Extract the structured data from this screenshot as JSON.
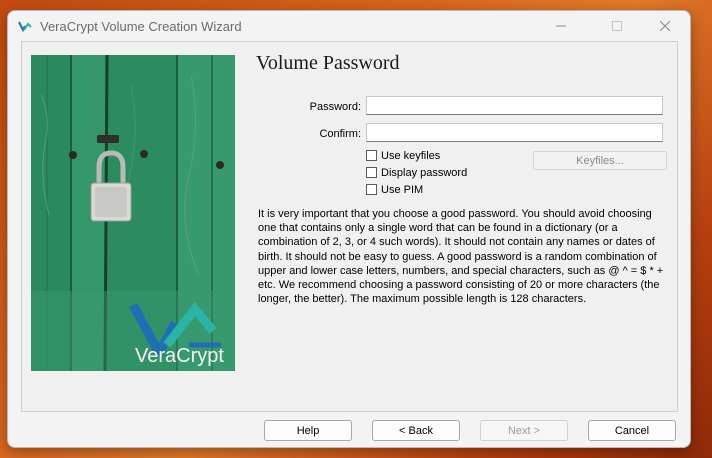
{
  "window": {
    "title": "VeraCrypt Volume Creation Wizard"
  },
  "page": {
    "title": "Volume Password"
  },
  "form": {
    "password_label": "Password:",
    "password_value": "",
    "confirm_label": "Confirm:",
    "confirm_value": "",
    "use_keyfiles_label": "Use keyfiles",
    "use_keyfiles_checked": false,
    "display_password_label": "Display password",
    "display_password_checked": false,
    "use_pim_label": "Use PIM",
    "use_pim_checked": false,
    "keyfiles_button": "Keyfiles..."
  },
  "info": {
    "text": "It is very important that you choose a good password. You should avoid choosing one that contains only a single word that can be found in a dictionary (or a combination of 2, 3, or 4 such words). It should not contain any names or dates of birth. It should not be easy to guess. A good password is a random combination of upper and lower case letters, numbers, and special characters, such as @ ^ = $ * + etc. We recommend choosing a password consisting of 20 or more characters (the longer, the better). The maximum possible length is 128 characters."
  },
  "branding": {
    "logo_text": "VeraCrypt"
  },
  "buttons": {
    "help": "Help",
    "back": "< Back",
    "next": "Next >",
    "cancel": "Cancel"
  },
  "colors": {
    "accent_blue": "#1f6fb5",
    "accent_teal": "#2bb3a3",
    "door_green": "#2e8d61"
  }
}
